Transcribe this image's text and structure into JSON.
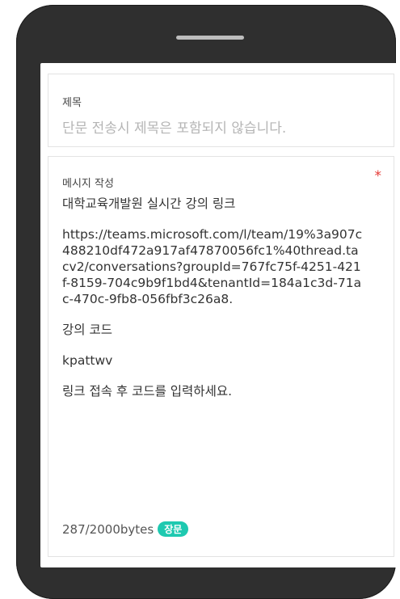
{
  "form": {
    "subject_label": "제목",
    "subject_placeholder": "단문 전송시 제목은 포함되지 않습니다.",
    "message_label": "메시지 작성",
    "required_mark": "*",
    "message_paragraphs": [
      "대학교육개발원 실시간 강의 링크",
      "https://teams.microsoft.com/l/team/19%3a907c488210df472a917af47870056fc1%40thread.tacv2/conversations?groupId=767fc75f-4251-421f-8159-704c9b9f1bd4&tenantId=184a1c3d-71ac-470c-9fb8-056fbf3c26a8.",
      "강의 코드",
      "kpattwv",
      "링크 접속 후 코드를 입력하세요."
    ],
    "byte_count": "287/2000bytes",
    "message_type_badge": "장문"
  }
}
